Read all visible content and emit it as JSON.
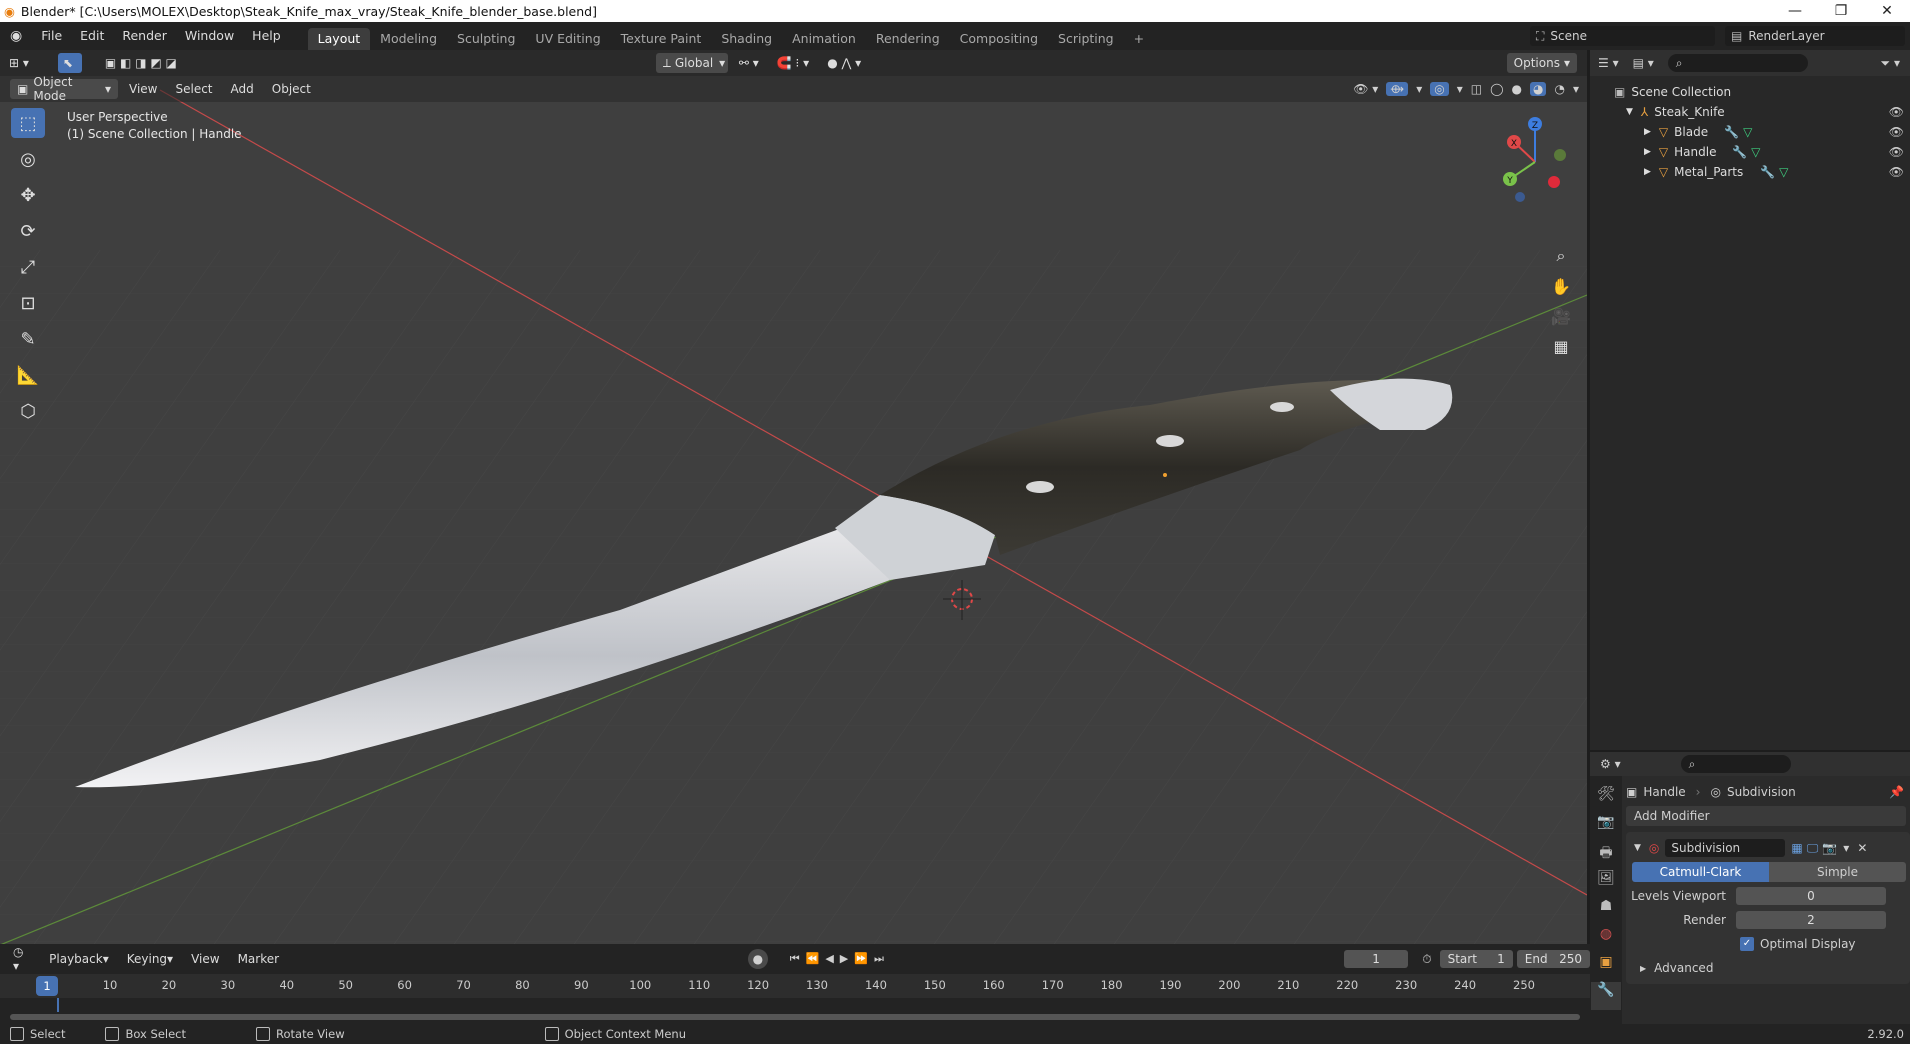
{
  "window": {
    "title": "Blender* [C:\\Users\\MOLEX\\Desktop\\Steak_Knife_max_vray/Steak_Knife_blender_base.blend]",
    "minimize": "—",
    "restore": "❐",
    "close": "✕"
  },
  "menu": [
    "File",
    "Edit",
    "Render",
    "Window",
    "Help"
  ],
  "workspaces": [
    {
      "label": "Layout",
      "active": true
    },
    {
      "label": "Modeling"
    },
    {
      "label": "Sculpting"
    },
    {
      "label": "UV Editing"
    },
    {
      "label": "Texture Paint"
    },
    {
      "label": "Shading"
    },
    {
      "label": "Animation"
    },
    {
      "label": "Rendering"
    },
    {
      "label": "Compositing"
    },
    {
      "label": "Scripting"
    }
  ],
  "add_workspace": "+",
  "scene": {
    "name": "Scene",
    "render_layer": "RenderLayer"
  },
  "viewport": {
    "transform_orientation": "Global",
    "options_label": "Options",
    "mode": "Object Mode",
    "menus": [
      "View",
      "Select",
      "Add",
      "Object"
    ],
    "perspective_label": "User Perspective",
    "collection_label": "(1) Scene Collection | Handle",
    "axis_x": "X",
    "axis_y": "Y",
    "axis_z": "Z"
  },
  "outliner": {
    "root": "Scene Collection",
    "collection": "Steak_Knife",
    "objects": [
      "Blade",
      "Handle",
      "Metal_Parts"
    ]
  },
  "properties": {
    "object": "Handle",
    "modifier_tab": "Subdivision",
    "add_modifier": "Add Modifier",
    "modifier_name": "Subdivision",
    "algorithms": [
      "Catmull-Clark",
      "Simple"
    ],
    "levels_viewport_label": "Levels Viewport",
    "levels_viewport": "0",
    "render_label": "Render",
    "render_levels": "2",
    "optimal_display": "Optimal Display",
    "advanced": "Advanced"
  },
  "timeline": {
    "menus": [
      "Playback",
      "Keying",
      "View",
      "Marker"
    ],
    "current_frame": "1",
    "start_label": "Start",
    "start": "1",
    "end_label": "End",
    "end": "250",
    "ticks": [
      "1",
      "10",
      "20",
      "30",
      "40",
      "50",
      "60",
      "70",
      "80",
      "90",
      "100",
      "110",
      "120",
      "130",
      "140",
      "150",
      "160",
      "170",
      "180",
      "190",
      "200",
      "210",
      "220",
      "230",
      "240",
      "250"
    ]
  },
  "status": {
    "select": "Select",
    "box_select": "Box Select",
    "rotate_view": "Rotate View",
    "context_menu": "Object Context Menu",
    "version": "2.92.0"
  },
  "colors": {
    "accent": "#4772b3",
    "x_axis": "#e04848",
    "y_axis": "#7ac24a",
    "z_axis": "#3d7ddf"
  }
}
